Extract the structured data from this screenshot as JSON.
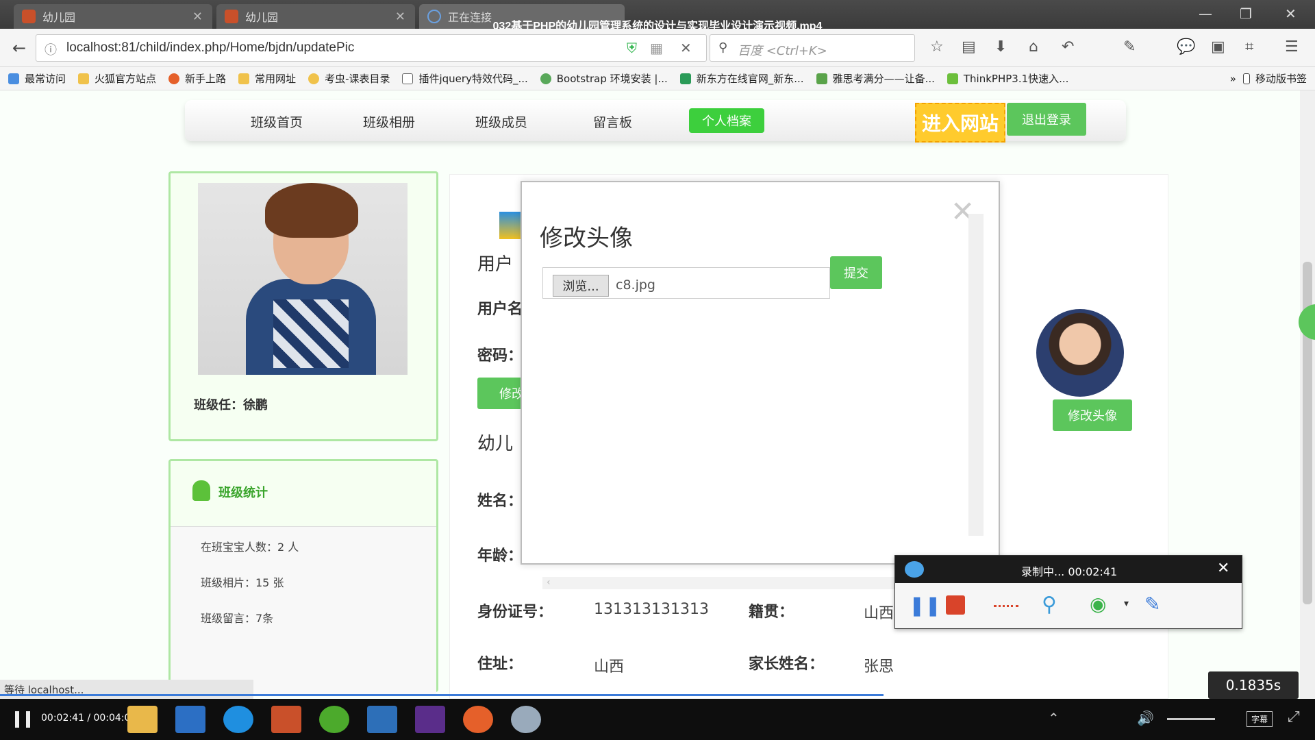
{
  "window": {
    "title": "032基于PHP的幼儿园管理系统的设计与实现毕业设计演示视频.mp4",
    "tabs": [
      {
        "label": "幼儿园"
      },
      {
        "label": "幼儿园"
      },
      {
        "label": "正在连接"
      }
    ]
  },
  "navbar": {
    "url": "localhost:81/child/index.php/Home/bjdn/updatePic",
    "search_placeholder": "百度 <Ctrl+K>"
  },
  "bookmarks": [
    "最常访问",
    "火狐官方站点",
    "新手上路",
    "常用网址",
    "考虫-课表目录",
    "插件jquery特效代码_...",
    "Bootstrap 环境安装 |...",
    "新东方在线官网_新东...",
    "雅思考满分——让备...",
    "ThinkPHP3.1快速入...",
    "移动版书签"
  ],
  "site_nav": {
    "items": [
      "班级首页",
      "班级相册",
      "班级成员",
      "留言板"
    ],
    "active": "个人档案",
    "enter_site": "进入网站",
    "logout": "退出登录"
  },
  "left": {
    "teacher_label": "班级任：徐鹏",
    "stats_title": "班级统计",
    "stats": [
      "在班宝宝人数：2 人",
      "班级相片：15 张",
      "班级留言：7条"
    ]
  },
  "main": {
    "section_user": "用户",
    "username_label": "用户名",
    "password_label": "密码：",
    "change_pw_button": "修改",
    "section_child": "幼儿",
    "name_label": "姓名：",
    "age_label": "年龄：",
    "id_label": "身份证号：",
    "id_value": "131313131313",
    "native_label": "籍贯：",
    "native_value": "山西",
    "address_label": "住址：",
    "address_value": "山西",
    "parent_label": "家长姓名：",
    "parent_value": "张思",
    "change_avatar_button": "修改头像"
  },
  "modal": {
    "title": "修改头像",
    "browse_label": "浏览...",
    "file_name": "c8.jpg",
    "submit_label": "提交"
  },
  "recorder": {
    "status": "录制中... 00:02:41"
  },
  "statusbar": {
    "text": "等待 localhost..."
  },
  "player": {
    "timecode": "00:02:41 / 00:04:00",
    "net_speed": "0.1835s",
    "subtitle_label": "字幕"
  }
}
